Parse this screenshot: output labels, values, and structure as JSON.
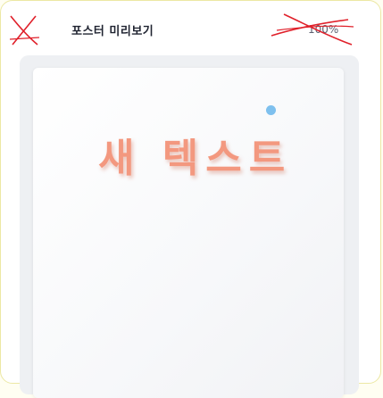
{
  "header": {
    "title": "포스터 미리보기",
    "zoom": "100%"
  },
  "poster": {
    "text": "새 텍스트",
    "text_color": "#f3987f"
  },
  "annotations": {
    "scribble_color": "#e0202a"
  }
}
